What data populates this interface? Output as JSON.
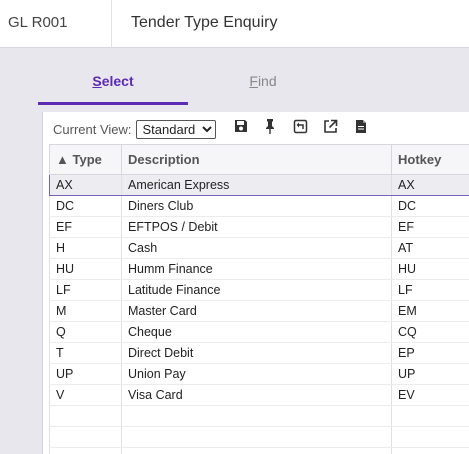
{
  "header": {
    "app_code": "GL R001",
    "title": "Tender Type Enquiry"
  },
  "tabs": [
    {
      "first": "S",
      "rest": "elect",
      "active": true
    },
    {
      "first": "F",
      "rest": "ind",
      "active": false
    }
  ],
  "toolbar": {
    "current_view_label": "Current View:",
    "view_options": [
      "Standard"
    ],
    "selected_view": "Standard",
    "icons": [
      "save-icon",
      "pin-icon",
      "restore-icon",
      "export-icon",
      "document-icon"
    ]
  },
  "grid": {
    "sort_indicator": "▲",
    "columns": [
      "Type",
      "Description",
      "Hotkey"
    ],
    "rows": [
      [
        "AX",
        "American Express",
        "AX"
      ],
      [
        "DC",
        "Diners Club",
        "DC"
      ],
      [
        "EF",
        "EFTPOS / Debit",
        "EF"
      ],
      [
        "H",
        "Cash",
        "AT"
      ],
      [
        "HU",
        "Humm Finance",
        "HU"
      ],
      [
        "LF",
        "Latitude Finance",
        "LF"
      ],
      [
        "M",
        "Master Card",
        "EM"
      ],
      [
        "Q",
        "Cheque",
        "CQ"
      ],
      [
        "T",
        "Direct Debit",
        "EP"
      ],
      [
        "UP",
        "Union Pay",
        "UP"
      ],
      [
        "V",
        "Visa Card",
        "EV"
      ]
    ],
    "selected_row": 0
  },
  "colors": {
    "accent": "#5b2bb5",
    "background": "#e8e7ee"
  }
}
